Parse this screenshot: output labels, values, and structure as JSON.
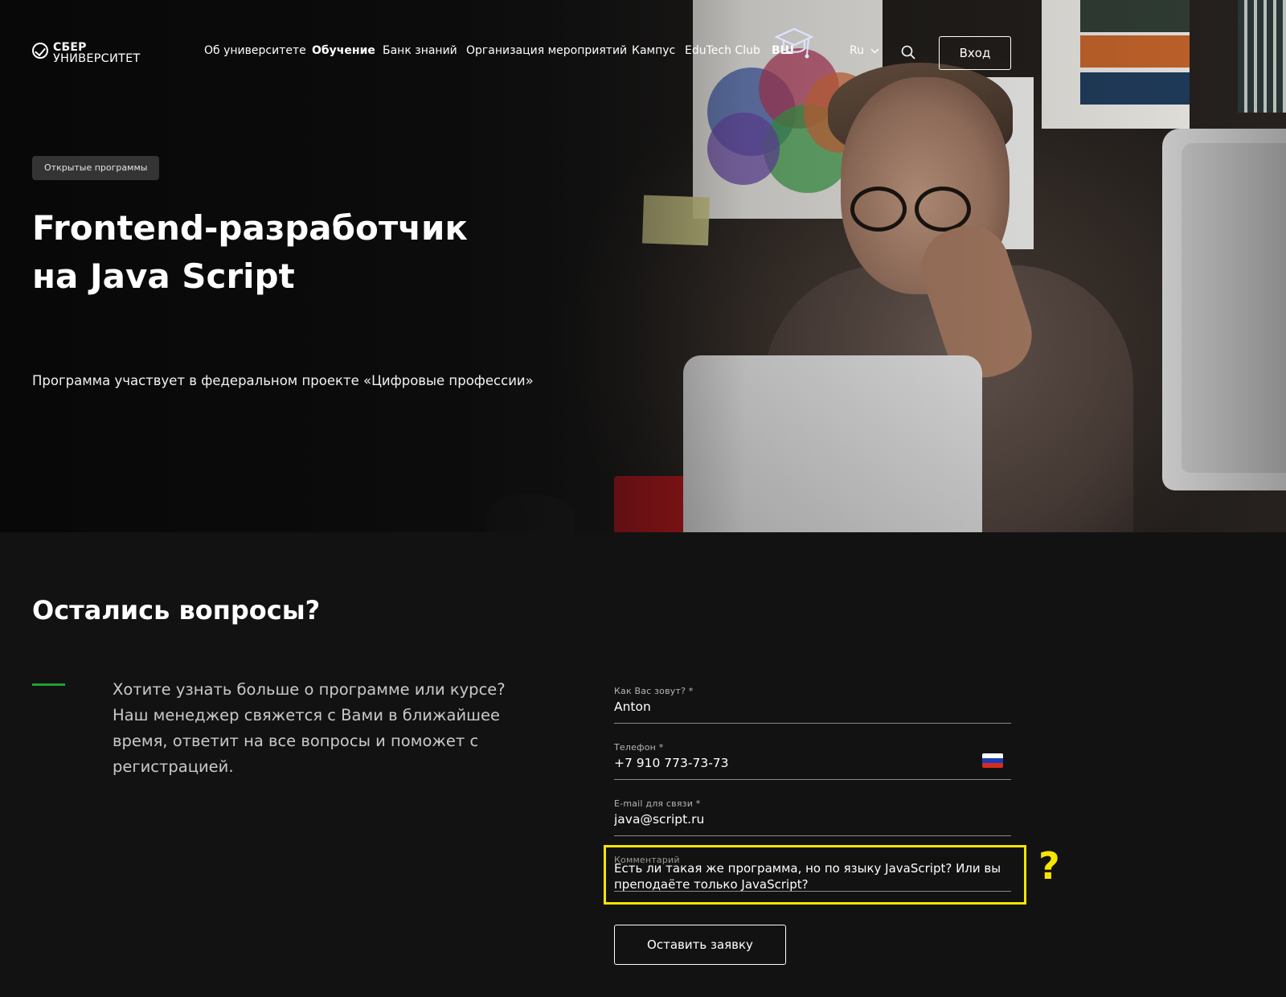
{
  "header": {
    "logo_line1": "СБЕР",
    "logo_line2": "УНИВЕРСИТЕТ",
    "nav": [
      {
        "label": "Об университете",
        "bold": false
      },
      {
        "label": "Обучение",
        "bold": true
      },
      {
        "label": "Банк знаний",
        "bold": false
      },
      {
        "label": "Организация мероприятий",
        "bold": false
      },
      {
        "label": "Кампус",
        "bold": false
      },
      {
        "label": "EduTech Club",
        "bold": false
      },
      {
        "label": "ВШ",
        "bold": false
      }
    ],
    "language": "Ru",
    "login_label": "Вход",
    "icons": [
      "check-circle-icon",
      "graduation-cap-icon",
      "chevron-down-icon",
      "search-icon"
    ]
  },
  "hero": {
    "tag": "Открытые программы",
    "title_line1": "Frontend-разработчик",
    "title_line2": "на Java Script",
    "subtitle": "Программа участвует в федеральном проекте «Цифровые профессии»"
  },
  "questions": {
    "title": "Остались вопросы?",
    "description": "Хотите узнать больше о программе или курсе? Наш менеджер свяжется с Вами в ближайшее время, ответит на все вопросы и поможет с регистрацией.",
    "accent_color": "#21a038"
  },
  "form": {
    "name": {
      "label": "Как Вас зовут? *",
      "value": "Anton"
    },
    "phone": {
      "label": "Телефон *",
      "value": "+7 910 773-73-73",
      "flag_icon": "russia-flag-icon"
    },
    "email": {
      "label": "E-mail для связи *",
      "value": "java@script.ru"
    },
    "comment": {
      "label": "Комментарий",
      "value": "Есть ли такая же программа, но по языку JavaScript? Или вы преподаёте только JavaScript?"
    },
    "submit_label": "Оставить заявку"
  },
  "annotation": {
    "highlight_color": "#f5e500",
    "mark": "?"
  }
}
